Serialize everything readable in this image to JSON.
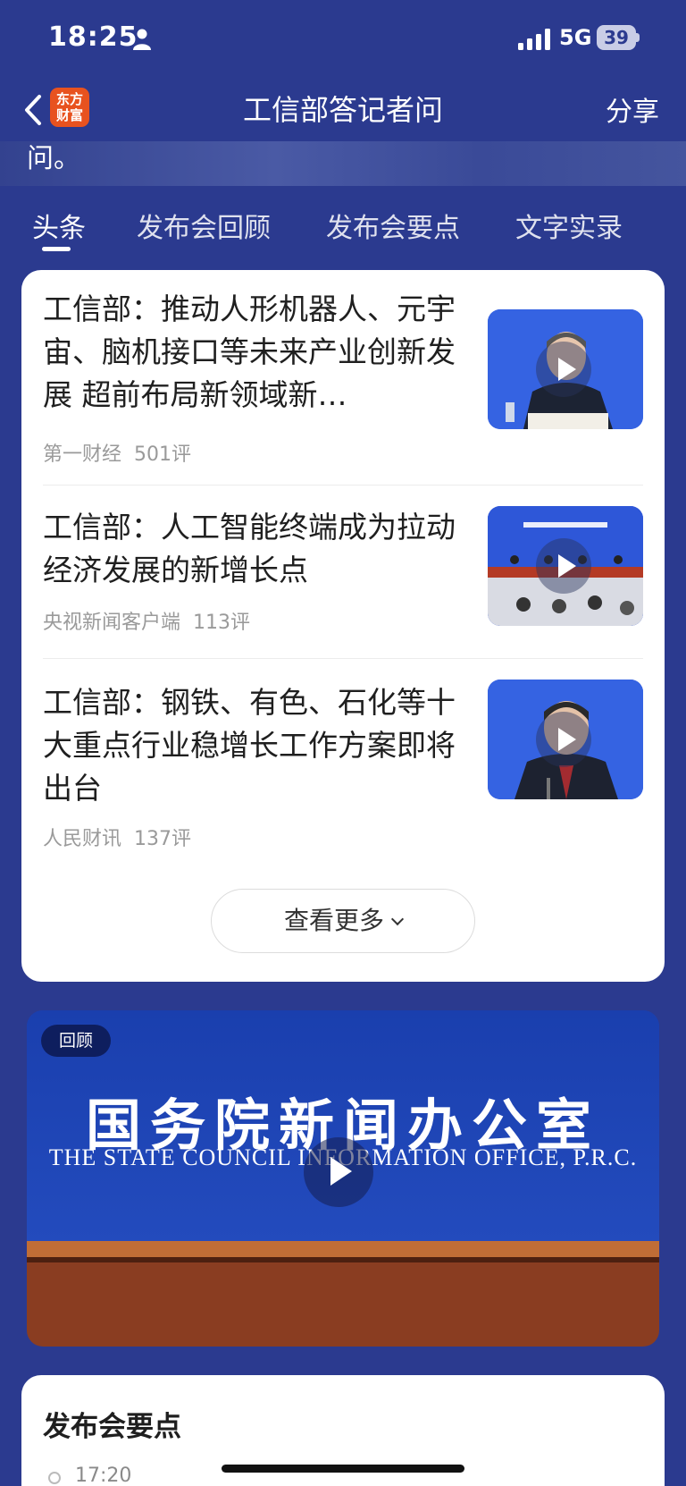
{
  "status_bar": {
    "time": "18:25",
    "network": "5G",
    "battery": "39"
  },
  "nav": {
    "title": "工信部答记者问",
    "share_label": "分享",
    "logo_text": "东方财富"
  },
  "hero": {
    "text": "问。"
  },
  "tabs": [
    {
      "label": "头条",
      "active": true
    },
    {
      "label": "发布会回顾"
    },
    {
      "label": "发布会要点"
    },
    {
      "label": "文字实录"
    }
  ],
  "news": [
    {
      "title": "工信部：推动人形机器人、元宇宙、脑机接口等未来产业创新发展 超前布局新领域新…",
      "source": "第一财经",
      "comments": "501评"
    },
    {
      "title": "工信部：人工智能终端成为拉动经济发展的新增长点",
      "source": "央视新闻客户端",
      "comments": "113评"
    },
    {
      "title": "工信部：钢铁、有色、石化等十大重点行业稳增长工作方案即将出台",
      "source": "人民财讯",
      "comments": "137评"
    }
  ],
  "more_button": "查看更多",
  "video": {
    "badge": "回顾",
    "title_cn": "国务院新闻办公室",
    "title_en": "THE STATE COUNCIL INFORMATION OFFICE, P.R.C."
  },
  "points": {
    "title": "发布会要点",
    "first_time": "17:20"
  }
}
